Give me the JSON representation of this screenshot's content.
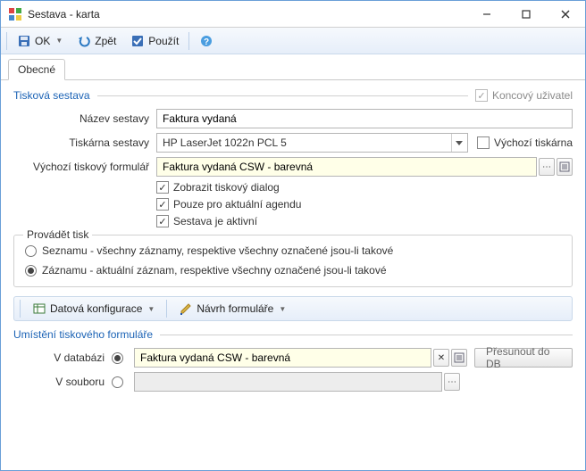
{
  "window": {
    "title": "Sestava - karta"
  },
  "toolbar": {
    "ok": "OK",
    "zpet": "Zpět",
    "pouzit": "Použít"
  },
  "tabs": {
    "obecne": "Obecné"
  },
  "group1": {
    "title": "Tisková sestava",
    "end_user": "Koncový uživatel",
    "name_label": "Název sestavy",
    "name_value": "Faktura vydaná",
    "printer_label": "Tiskárna sestavy",
    "printer_value": "HP LaserJet 1022n PCL 5",
    "default_printer": "Výchozí tiskárna",
    "form_label": "Výchozí tiskový formulář",
    "form_value": "Faktura vydaná CSW - barevná",
    "cb1": "Zobrazit tiskový dialog",
    "cb2": "Pouze pro aktuální agendu",
    "cb3": "Sestava je aktivní"
  },
  "group2": {
    "legend": "Provádět tisk",
    "opt1": "Seznamu - všechny záznamy, respektive všechny označené jsou-li takové",
    "opt2": "Záznamu - aktuální záznam, respektive všechny označené jsou-li takové"
  },
  "bar2": {
    "data_conf": "Datová konfigurace",
    "form_design": "Návrh formuláře"
  },
  "group3": {
    "title": "Umístění tiskového formuláře",
    "db_label": "V databázi",
    "db_value": "Faktura vydaná CSW - barevná",
    "move_db": "Přesunout do DB",
    "file_label": "V souboru",
    "file_value": ""
  }
}
